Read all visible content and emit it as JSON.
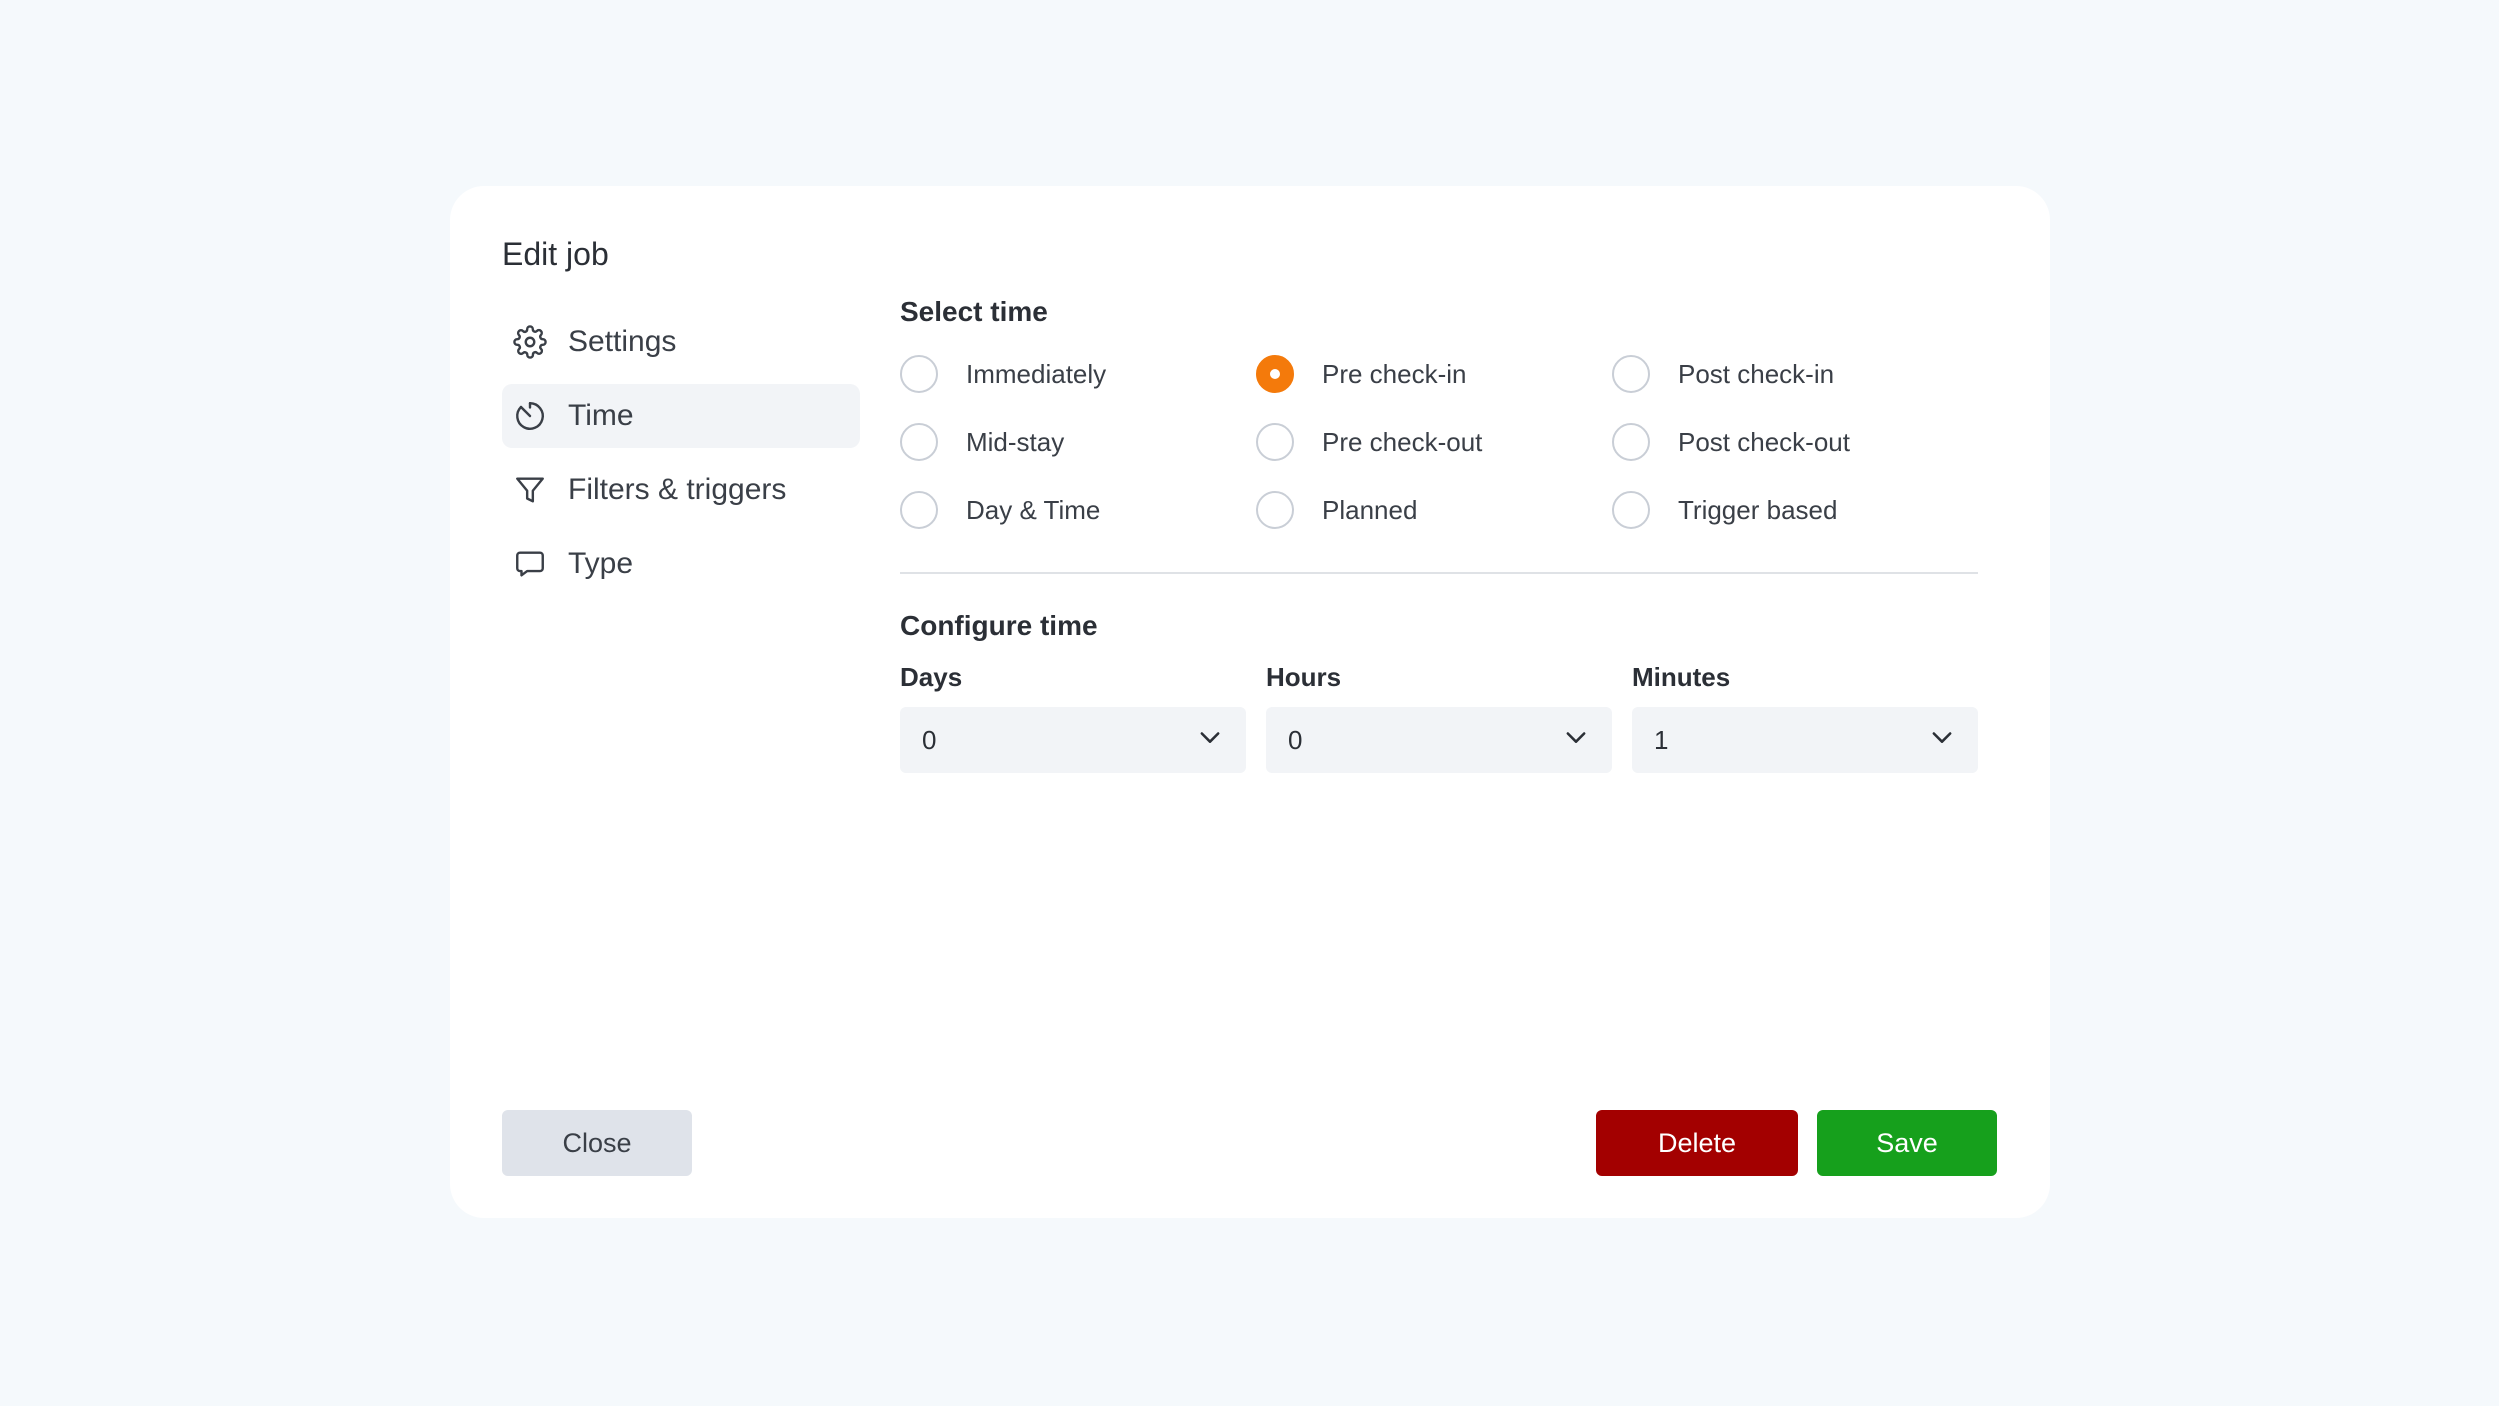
{
  "modal": {
    "title": "Edit job"
  },
  "sidebar": {
    "items": [
      {
        "label": "Settings",
        "icon": "gear-icon",
        "active": false
      },
      {
        "label": "Time",
        "icon": "clock-icon",
        "active": true
      },
      {
        "label": "Filters & triggers",
        "icon": "filter-icon",
        "active": false
      },
      {
        "label": "Type",
        "icon": "message-icon",
        "active": false
      }
    ]
  },
  "select_time": {
    "title": "Select time",
    "options": [
      {
        "label": "Immediately",
        "checked": false
      },
      {
        "label": "Pre check-in",
        "checked": true
      },
      {
        "label": "Post check-in",
        "checked": false
      },
      {
        "label": "Mid-stay",
        "checked": false
      },
      {
        "label": "Pre check-out",
        "checked": false
      },
      {
        "label": "Post check-out",
        "checked": false
      },
      {
        "label": "Day & Time",
        "checked": false
      },
      {
        "label": "Planned",
        "checked": false
      },
      {
        "label": "Trigger based",
        "checked": false
      }
    ]
  },
  "configure_time": {
    "title": "Configure time",
    "fields": [
      {
        "label": "Days",
        "value": "0"
      },
      {
        "label": "Hours",
        "value": "0"
      },
      {
        "label": "Minutes",
        "value": "1"
      }
    ]
  },
  "footer": {
    "close_label": "Close",
    "delete_label": "Delete",
    "save_label": "Save"
  },
  "colors": {
    "accent": "#f47a0b",
    "delete": "#a30000",
    "save": "#16a01c",
    "background": "#f5f9fc"
  }
}
